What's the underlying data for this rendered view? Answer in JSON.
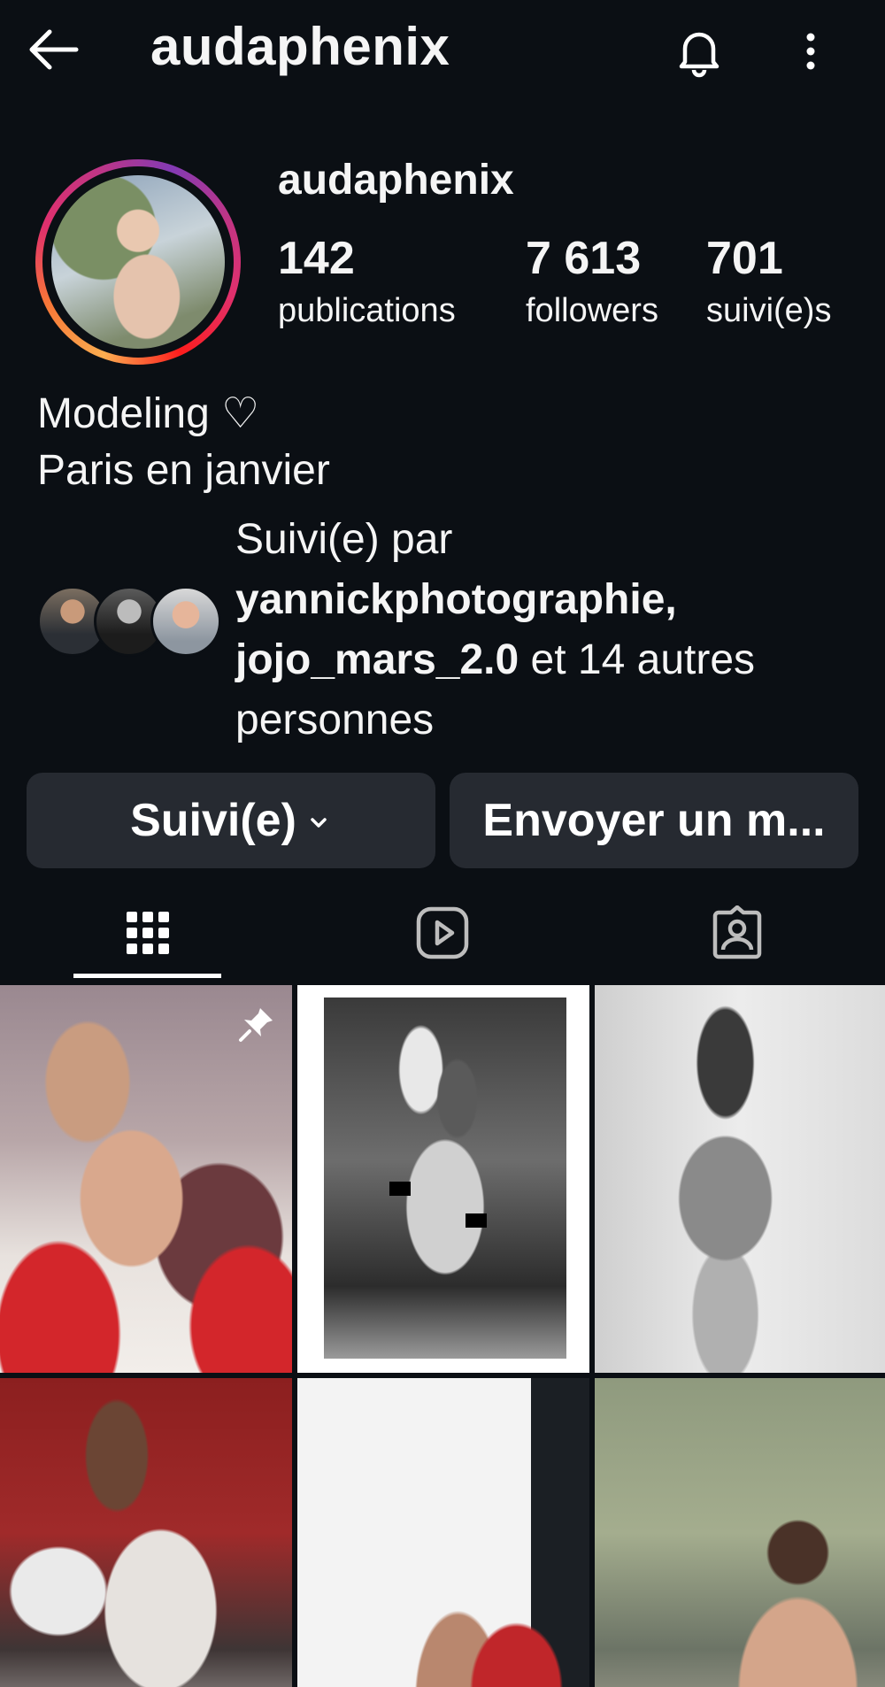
{
  "topbar": {
    "title": "audaphenix",
    "back_icon": "arrow-left-icon",
    "bell_icon": "bell-icon",
    "more_icon": "more-vertical-icon"
  },
  "profile": {
    "name": "audaphenix",
    "stats": [
      {
        "value": "142",
        "label": "publications"
      },
      {
        "value": "7 613",
        "label": "followers"
      },
      {
        "value": "701",
        "label": "suivi(e)s"
      }
    ],
    "bio_line1": "Modeling ♡",
    "bio_line2": "Paris en janvier"
  },
  "followed_by": {
    "prefix": "Suivi(e) par",
    "user1": "yannickphotographie,",
    "user2": "jojo_mars_2.0",
    "suffix": " et 14 autres personnes"
  },
  "actions": {
    "following_label": "Suivi(e)",
    "message_label": "Envoyer un m..."
  },
  "tabs": [
    {
      "icon": "grid-icon",
      "active": true
    },
    {
      "icon": "reels-icon",
      "active": false
    },
    {
      "icon": "tagged-icon",
      "active": false
    }
  ],
  "colors": {
    "background": "#0b0f14",
    "button": "#262a31",
    "text": "#f5f5f5"
  }
}
